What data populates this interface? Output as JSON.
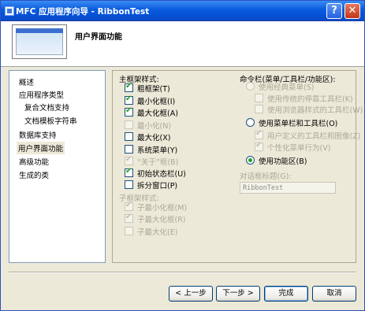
{
  "window": {
    "title": "MFC 应用程序向导 - RibbonTest",
    "help_glyph": "?",
    "close_glyph": "✕"
  },
  "header": {
    "title": "用户界面功能"
  },
  "sidebar": {
    "items": [
      {
        "label": "概述",
        "selected": false
      },
      {
        "label": "应用程序类型",
        "selected": false
      },
      {
        "label": "复合文档支持",
        "selected": false
      },
      {
        "label": "文档模板字符串",
        "selected": false
      },
      {
        "label": "数据库支持",
        "selected": false
      },
      {
        "label": "用户界面功能",
        "selected": true
      },
      {
        "label": "高级功能",
        "selected": false
      },
      {
        "label": "生成的类",
        "selected": false
      }
    ]
  },
  "main_frame": {
    "heading": "主框架样式:",
    "options": [
      {
        "label": "粗框架(T)",
        "checked": true,
        "enabled": true
      },
      {
        "label": "最小化框(I)",
        "checked": true,
        "enabled": true
      },
      {
        "label": "最大化框(A)",
        "checked": true,
        "enabled": true
      },
      {
        "label": "最小化(N)",
        "checked": false,
        "enabled": false
      },
      {
        "label": "最大化(X)",
        "checked": false,
        "enabled": true
      },
      {
        "label": "系统菜单(Y)",
        "checked": false,
        "enabled": true
      },
      {
        "label": "“关于”框(B)",
        "checked": true,
        "enabled": false
      },
      {
        "label": "初始状态栏(U)",
        "checked": true,
        "enabled": true
      },
      {
        "label": "拆分窗口(P)",
        "checked": false,
        "enabled": true
      }
    ]
  },
  "child_frame": {
    "heading": "子框架样式:",
    "options": [
      {
        "label": "子最小化框(M)",
        "checked": true,
        "enabled": false
      },
      {
        "label": "子最大化框(R)",
        "checked": true,
        "enabled": false
      },
      {
        "label": "子最大化(E)",
        "checked": false,
        "enabled": false
      }
    ]
  },
  "command_bar": {
    "heading": "命令栏(菜单/工具栏/功能区):",
    "classic": {
      "label": "使用经典菜单(S)",
      "selected": false,
      "enabled": false
    },
    "classic_sub": [
      {
        "label": "使用传统的停靠工具栏(K)",
        "checked": false
      },
      {
        "label": "使用浏览器样式的工具栏(W)",
        "checked": false
      }
    ],
    "menubar": {
      "label": "使用菜单栏和工具栏(O)",
      "selected": false,
      "enabled": true
    },
    "menubar_sub": [
      {
        "label": "用户定义的工具栏和图像(Z)",
        "checked": true
      },
      {
        "label": "个性化菜单行为(V)",
        "checked": true
      }
    ],
    "ribbon": {
      "label": "使用功能区(B)",
      "selected": true,
      "enabled": true
    }
  },
  "dialog_title": {
    "label": "对话框标题(G):",
    "value": "RibbonTest"
  },
  "buttons": {
    "back": "< 上一步",
    "next": "下一步 >",
    "finish": "完成",
    "cancel": "取消"
  },
  "colors": {
    "title_bar": "#0a5bdd",
    "face": "#ece9d8",
    "check": "#21a121"
  }
}
